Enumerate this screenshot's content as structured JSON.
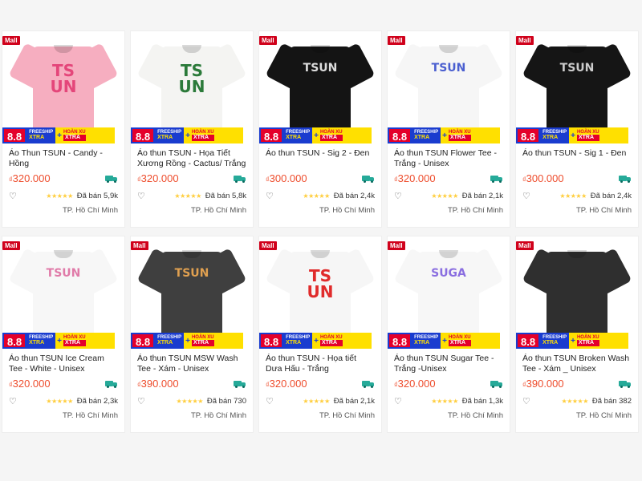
{
  "promo": {
    "badge_88": "8.8",
    "freeship_top": "FREESHIP",
    "freeship_bottom": "XTRA",
    "plus": "+",
    "hoanxu_top": "HOÀN XU",
    "hoanxu_bottom": "XTRA"
  },
  "mall_label": "Mall",
  "products": [
    {
      "name": "Áo Thun TSUN - Candy - Hồng",
      "currency": "₫",
      "price": "320.000",
      "rating_stars": "★★★★★",
      "sold": "Đã bán 5,9k",
      "location": "TP. Hồ Chí Minh",
      "mall": true,
      "shirt_color": "#f6aec0",
      "print_text": "TS UN",
      "print_color": "#e4467a"
    },
    {
      "name": "Áo thun TSUN - Họa Tiết Xương Rồng - Cactus/ Trắng",
      "currency": "₫",
      "price": "320.000",
      "rating_stars": "★★★★★",
      "sold": "Đã bán 5,8k",
      "location": "TP. Hồ Chí Minh",
      "mall": false,
      "shirt_color": "#f4f4f2",
      "print_text": "TS UN",
      "print_color": "#2b7a3a"
    },
    {
      "name": "Áo thun TSUN - Sig 2 - Đen",
      "currency": "₫",
      "price": "300.000",
      "rating_stars": "★★★★★",
      "sold": "Đã bán 2,4k",
      "location": "TP. Hồ Chí Minh",
      "mall": true,
      "shirt_color": "#141414",
      "print_text": "TSUN",
      "print_color": "#dddddd"
    },
    {
      "name": "Áo thun TSUN Flower Tee - Trắng - Unisex",
      "currency": "₫",
      "price": "320.000",
      "rating_stars": "★★★★★",
      "sold": "Đã bán 2,1k",
      "location": "TP. Hồ Chí Minh",
      "mall": true,
      "shirt_color": "#f6f6f6",
      "print_text": "TSUN",
      "print_color": "#4a5fd0"
    },
    {
      "name": "Áo thun TSUN - Sig 1 - Đen",
      "currency": "₫",
      "price": "300.000",
      "rating_stars": "★★★★★",
      "sold": "Đã bán 2,4k",
      "location": "TP. Hồ Chí Minh",
      "mall": true,
      "shirt_color": "#151515",
      "print_text": "TSUN",
      "print_color": "#cccccc"
    },
    {
      "name": "Áo thun TSUN Ice Cream Tee - White - Unisex",
      "currency": "₫",
      "price": "320.000",
      "rating_stars": "★★★★★",
      "sold": "Đã bán 2,3k",
      "location": "TP. Hồ Chí Minh",
      "mall": true,
      "shirt_color": "#f7f7f7",
      "print_text": "TSUN",
      "print_color": "#e07aa8"
    },
    {
      "name": "Áo thun TSUN MSW Wash Tee - Xám - Unisex",
      "currency": "₫",
      "price": "390.000",
      "rating_stars": "★★★★★",
      "sold": "Đã bán 730",
      "location": "TP. Hồ Chí Minh",
      "mall": true,
      "shirt_color": "#3f3f3f",
      "print_text": "TSUN",
      "print_color": "#e0a050"
    },
    {
      "name": "Áo thun TSUN - Họa tiết Dưa Hấu - Trắng",
      "currency": "₫",
      "price": "320.000",
      "rating_stars": "★★★★★",
      "sold": "Đã bán 2,1k",
      "location": "TP. Hồ Chí Minh",
      "mall": true,
      "shirt_color": "#f6f6f6",
      "print_text": "TS UN",
      "print_color": "#e02b2b"
    },
    {
      "name": "Áo thun TSUN Sugar Tee - Trắng -Unisex",
      "currency": "₫",
      "price": "320.000",
      "rating_stars": "★★★★★",
      "sold": "Đã bán 1,3k",
      "location": "TP. Hồ Chí Minh",
      "mall": true,
      "shirt_color": "#f7f7f7",
      "print_text": "SUGA",
      "print_color": "#8a6ee0"
    },
    {
      "name": "Áo thun TSUN Broken Wash Tee - Xám _ Unisex",
      "currency": "₫",
      "price": "390.000",
      "rating_stars": "★★★★★",
      "sold": "Đã bán 382",
      "location": "TP. Hồ Chí Minh",
      "mall": true,
      "shirt_color": "#2f2f2f",
      "print_text": "",
      "print_color": "#bbbbbb"
    }
  ]
}
